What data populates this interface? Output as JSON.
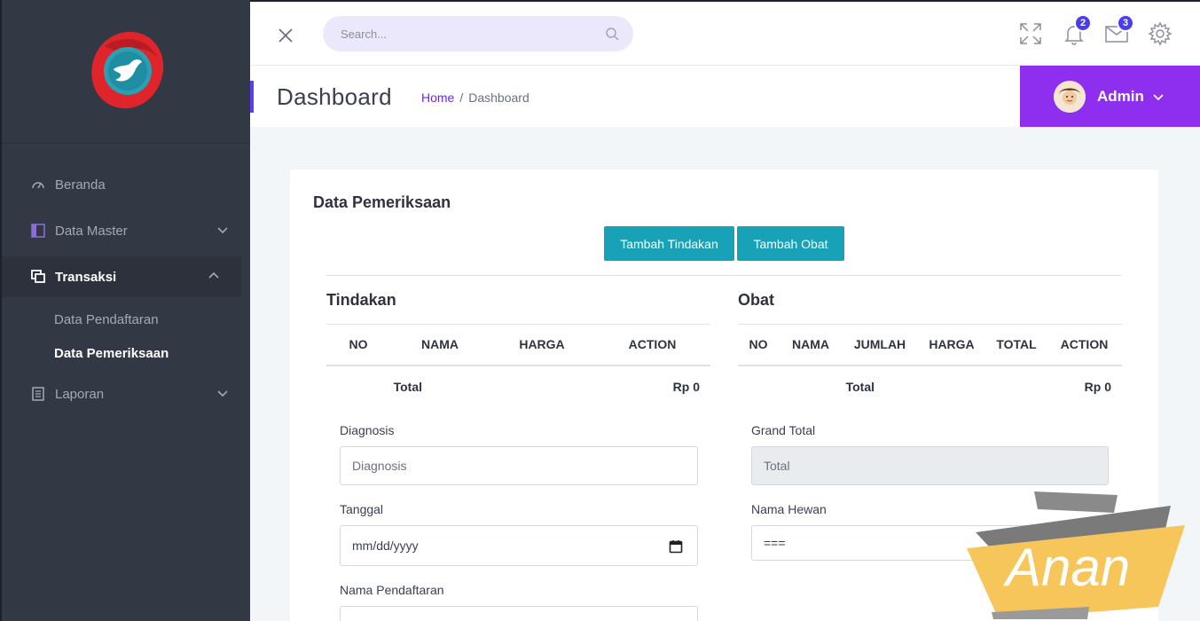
{
  "sidebar": {
    "items": [
      {
        "label": "Beranda",
        "icon": "dashboard-icon"
      },
      {
        "label": "Data Master",
        "icon": "folder-icon"
      },
      {
        "label": "Transaksi",
        "icon": "copy-icon"
      },
      {
        "label": "Laporan",
        "icon": "report-icon"
      }
    ],
    "sub_items": [
      "Data Pendaftaran",
      "Data Pemeriksaan"
    ]
  },
  "topbar": {
    "search_placeholder": "Search...",
    "notifications_count": "2",
    "messages_count": "3"
  },
  "header": {
    "title": "Dashboard",
    "breadcrumb_home": "Home",
    "breadcrumb_sep": "/",
    "breadcrumb_current": "Dashboard",
    "user_name": "Admin"
  },
  "card": {
    "title": "Data Pemeriksaan",
    "btn_tindakan": "Tambah Tindakan",
    "btn_obat": "Tambah Obat",
    "tindakan": {
      "title": "Tindakan",
      "columns": [
        "NO",
        "NAMA",
        "HARGA",
        "ACTION"
      ],
      "total_label": "Total",
      "total_value": "Rp 0"
    },
    "obat": {
      "title": "Obat",
      "columns": [
        "NO",
        "NAMA",
        "JUMLAH",
        "HARGA",
        "TOTAL",
        "ACTION"
      ],
      "total_label": "Total",
      "total_value": "Rp 0"
    },
    "form": {
      "diagnosis_label": "Diagnosis",
      "diagnosis_placeholder": "Diagnosis",
      "tanggal_label": "Tanggal",
      "tanggal_placeholder": "mm/dd/yyyy",
      "pendaftaran_label": "Nama Pendaftaran",
      "grand_total_label": "Grand Total",
      "grand_total_placeholder": "Total",
      "hewan_label": "Nama Hewan",
      "hewan_selected": "==="
    }
  },
  "watermark": {
    "text": "Anan"
  },
  "colors": {
    "sidebar_bg": "#323844",
    "accent_purple": "#8e2ff0",
    "button_teal": "#17a2b8",
    "badge": "#4a3dea"
  }
}
